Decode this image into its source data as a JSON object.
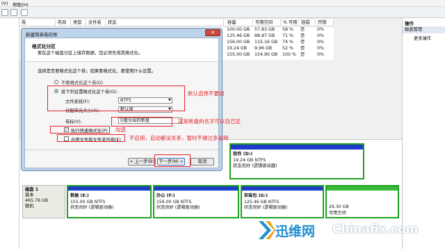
{
  "menu": {
    "view_label": "(V)",
    "help_label": "帮助(H)"
  },
  "volumes": {
    "headers": [
      "卷",
      "布局",
      "类型",
      "文件系统",
      "状态",
      "容量",
      "可用空间",
      "% 可用",
      "容错",
      "开销"
    ],
    "rows": [
      {
        "capacity": "100.00 GB",
        "free": "57.83 GB",
        "pct": "58 %",
        "fault": "否",
        "overhead": "0%"
      },
      {
        "capacity": "125.46 GB",
        "free": "88.87 GB",
        "pct": "71 %",
        "fault": "否",
        "overhead": "0%"
      },
      {
        "capacity": "156.00 GB",
        "free": "115.16 GB",
        "pct": "74 %",
        "fault": "否",
        "overhead": "0%"
      },
      {
        "capacity": "19.24 GB",
        "free": "9.96 GB",
        "pct": "52 %",
        "fault": "否",
        "overhead": "0%"
      },
      {
        "capacity": "155.00 GB",
        "free": "154.90 GB",
        "pct": "100 %",
        "fault": "否",
        "overhead": "0%"
      }
    ]
  },
  "ops": {
    "title": "操作",
    "group": "磁盘管理",
    "more": "更多操作"
  },
  "dialog": {
    "title": "新建简单卷向导",
    "heading": "格式化分区",
    "subheading": "要在这个磁盘分区上储存数据，您必须先将其格式化。",
    "question": "选择是否要格式化这个卷；如果要格式化，要使用什么设置。",
    "opt_noformat": "不要格式化这个卷(D)",
    "opt_format": "按下列设置格式化这个卷(O):",
    "fs_label": "文件系统(F):",
    "fs_value": "NTFS",
    "alloc_label": "分配单元大小(A):",
    "alloc_value": "默认值",
    "vol_label": "卷标(V):",
    "vol_value": "D盘分出的新盘",
    "quick_label": "执行快速格式化(P)",
    "compress_label": "启用文件和文件夹压缩(E)",
    "back_btn": "< 上一步(B)",
    "next_btn": "下一步(N) >",
    "cancel_btn": "取消"
  },
  "annotations": {
    "default": "默认选择不要动",
    "name": "就是新盘的名字可以自己定",
    "check": "勾选",
    "disable": "不启用，启动都没关系，暂时不做过多说明"
  },
  "disk": {
    "name": "磁盘 1",
    "type": "基本",
    "size": "465.76 GB",
    "status": "联机"
  },
  "partitions": {
    "D": {
      "name": "软件 (D:)",
      "size": "19.24 GB NTFS",
      "status": "状态良好 (逻辑驱动器)"
    },
    "E": {
      "name": "数据 (E:)",
      "size": "155.00 GB NTFS",
      "status": "状态良好 (逻辑驱动器)"
    },
    "F": {
      "name": "办公 (F:)",
      "size": "156.00 GB NTFS",
      "status": "状态良好 (逻辑驱动器)"
    },
    "G": {
      "name": "安装包 (G:)",
      "size": "125.46 GB NTFS",
      "status": "状态良好 (逻辑驱动器)"
    },
    "free": {
      "size": "29.30 GB",
      "status": "可用空间"
    }
  },
  "watermark": {
    "cn": "迅维网",
    "en": "Chinafix.com"
  },
  "colors": {
    "partition_bar": "#1c3cc9",
    "selection": "#1fa01f",
    "annotation": "#e3242b"
  }
}
